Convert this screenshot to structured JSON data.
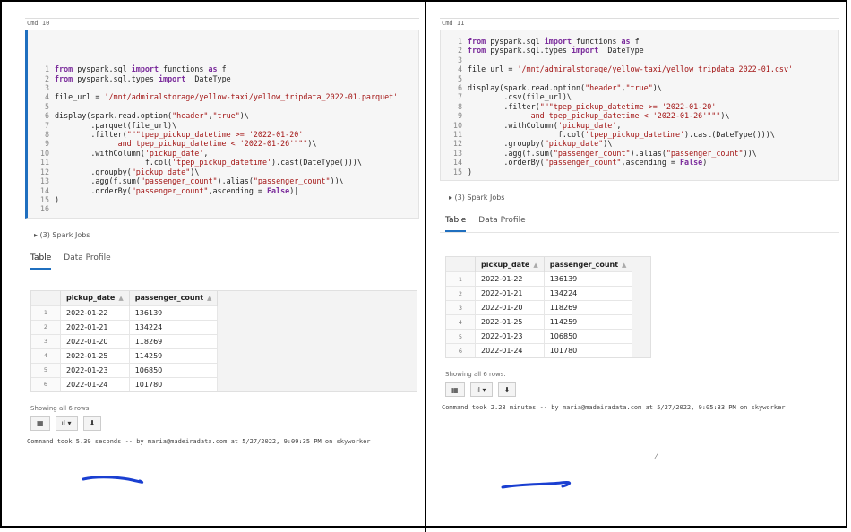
{
  "left": {
    "cmd_label": "Cmd 10",
    "code": [
      {
        "n": "1",
        "html": "<span class='kw'>from</span> pyspark.sql <span class='kw'>import</span> functions <span class='kw'>as</span> f"
      },
      {
        "n": "2",
        "html": "<span class='kw'>from</span> pyspark.sql.types <span class='kw'>import</span>  DateType"
      },
      {
        "n": "3",
        "html": ""
      },
      {
        "n": "4",
        "html": "file_url = <span class='st'>'/mnt/admiralstorage/yellow-taxi/yellow_tripdata_2022-01.parquet'</span>"
      },
      {
        "n": "5",
        "html": ""
      },
      {
        "n": "6",
        "html": "display(spark.read.option(<span class='st'>\"header\"</span>,<span class='st'>\"true\"</span>)\\"
      },
      {
        "n": "7",
        "html": "        .parquet(file_url)\\"
      },
      {
        "n": "8",
        "html": "        .filter(<span class='st'>\"\"\"tpep_pickup_datetime >= '2022-01-20'</span>"
      },
      {
        "n": "9",
        "html": "<span class='st'>              and tpep_pickup_datetime < '2022-01-26'\"\"\"</span>)\\"
      },
      {
        "n": "10",
        "html": "        .withColumn(<span class='st'>'pickup_date'</span>,"
      },
      {
        "n": "11",
        "html": "                    f.col(<span class='st'>'tpep_pickup_datetime'</span>).cast(DateType()))\\"
      },
      {
        "n": "12",
        "html": "        .groupby(<span class='st'>\"pickup_date\"</span>)\\"
      },
      {
        "n": "13",
        "html": "        .agg(f.sum(<span class='st'>\"passenger_count\"</span>).alias(<span class='st'>\"passenger_count\"</span>))\\"
      },
      {
        "n": "14",
        "html": "        .orderBy(<span class='st'>\"passenger_count\"</span>,ascending = <span class='kw'>False</span>)|"
      },
      {
        "n": "15",
        "html": ")"
      },
      {
        "n": "16",
        "html": ""
      }
    ],
    "spark_jobs": "▸ (3) Spark Jobs",
    "tabs": [
      "Table",
      "Data Profile"
    ],
    "showing": "Showing all 6 rows.",
    "command_took": "Command took 5.39 seconds -- by maria@madeiradata.com at 5/27/2022, 9:09:35 PM on skyworker"
  },
  "right": {
    "cmd_label": "Cmd 11",
    "code": [
      {
        "n": "1",
        "html": "<span class='kw'>from</span> pyspark.sql <span class='kw'>import</span> functions <span class='kw'>as</span> f"
      },
      {
        "n": "2",
        "html": "<span class='kw'>from</span> pyspark.sql.types <span class='kw'>import</span>  DateType"
      },
      {
        "n": "3",
        "html": ""
      },
      {
        "n": "4",
        "html": "file_url = <span class='st'>'/mnt/admiralstorage/yellow-taxi/yellow_tripdata_2022-01.csv'</span>"
      },
      {
        "n": "5",
        "html": ""
      },
      {
        "n": "6",
        "html": "display(spark.read.option(<span class='st'>\"header\"</span>,<span class='st'>\"true\"</span>)\\"
      },
      {
        "n": "7",
        "html": "        .csv(file_url)\\"
      },
      {
        "n": "8",
        "html": "        .filter(<span class='st'>\"\"\"tpep_pickup_datetime >= '2022-01-20'</span>"
      },
      {
        "n": "9",
        "html": "<span class='st'>              and tpep_pickup_datetime < '2022-01-26'\"\"\"</span>)\\"
      },
      {
        "n": "10",
        "html": "        .withColumn(<span class='st'>'pickup_date'</span>,"
      },
      {
        "n": "11",
        "html": "                    f.col(<span class='st'>'tpep_pickup_datetime'</span>).cast(DateType()))\\"
      },
      {
        "n": "12",
        "html": "        .groupby(<span class='st'>\"pickup_date\"</span>)\\"
      },
      {
        "n": "13",
        "html": "        .agg(f.sum(<span class='st'>\"passenger_count\"</span>).alias(<span class='st'>\"passenger_count\"</span>))\\"
      },
      {
        "n": "14",
        "html": "        .orderBy(<span class='st'>\"passenger_count\"</span>,ascending = <span class='kw'>False</span>)"
      },
      {
        "n": "15",
        "html": ")"
      }
    ],
    "spark_jobs": "▸ (3) Spark Jobs",
    "tabs": [
      "Table",
      "Data Profile"
    ],
    "showing": "Showing all 6 rows.",
    "command_took": "Command took 2.28 minutes -- by maria@madeiradata.com at 5/27/2022, 9:05:33 PM on skyworker"
  },
  "table": {
    "headers": [
      "pickup_date",
      "passenger_count"
    ],
    "rows": [
      [
        "1",
        "2022-01-22",
        "136139"
      ],
      [
        "2",
        "2022-01-21",
        "134224"
      ],
      [
        "3",
        "2022-01-20",
        "118269"
      ],
      [
        "4",
        "2022-01-25",
        "114259"
      ],
      [
        "5",
        "2022-01-23",
        "106850"
      ],
      [
        "6",
        "2022-01-24",
        "101780"
      ]
    ]
  },
  "buttons": [
    "▦",
    "ıl ▾",
    "⬇"
  ],
  "expand_glyph": ">",
  "colors": {
    "accent": "#1f6fbf",
    "annotation": "#1a3fd1"
  }
}
